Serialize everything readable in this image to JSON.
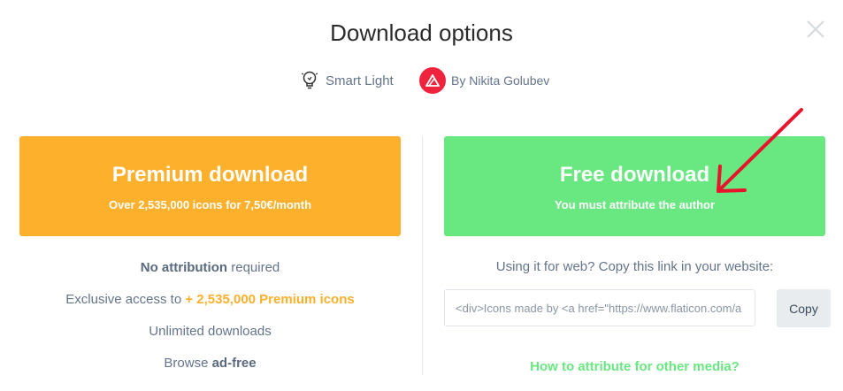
{
  "dialog": {
    "title": "Download options",
    "pack_name": "Smart Light",
    "author_label": "By Nikita Golubev"
  },
  "premium": {
    "title": "Premium download",
    "subtitle": "Over 2,535,000 icons for 7,50€/month",
    "features": [
      {
        "bold": "No attribution",
        "text": " required"
      },
      {
        "text": "Exclusive access to ",
        "highlight": "+ 2,535,000 Premium icons"
      },
      {
        "text": "Unlimited downloads"
      },
      {
        "text": "Browse ",
        "bold": "ad-free"
      }
    ]
  },
  "free": {
    "title": "Free download",
    "subtitle": "You must attribute the author",
    "hint": "Using it for web? Copy this link in your website:",
    "link_value": "<div>Icons made by <a href=\"https://www.flaticon.com/a",
    "copy_label": "Copy",
    "other_media_link": "How to attribute for other media?"
  },
  "colors": {
    "premium": "#fdb02c",
    "free": "#69e780",
    "author_avatar": "#ef233c",
    "annotation_arrow": "#e8142b"
  },
  "icons": {
    "close": "close-icon",
    "pack": "light-bulb-icon",
    "author": "author-logo-icon"
  }
}
